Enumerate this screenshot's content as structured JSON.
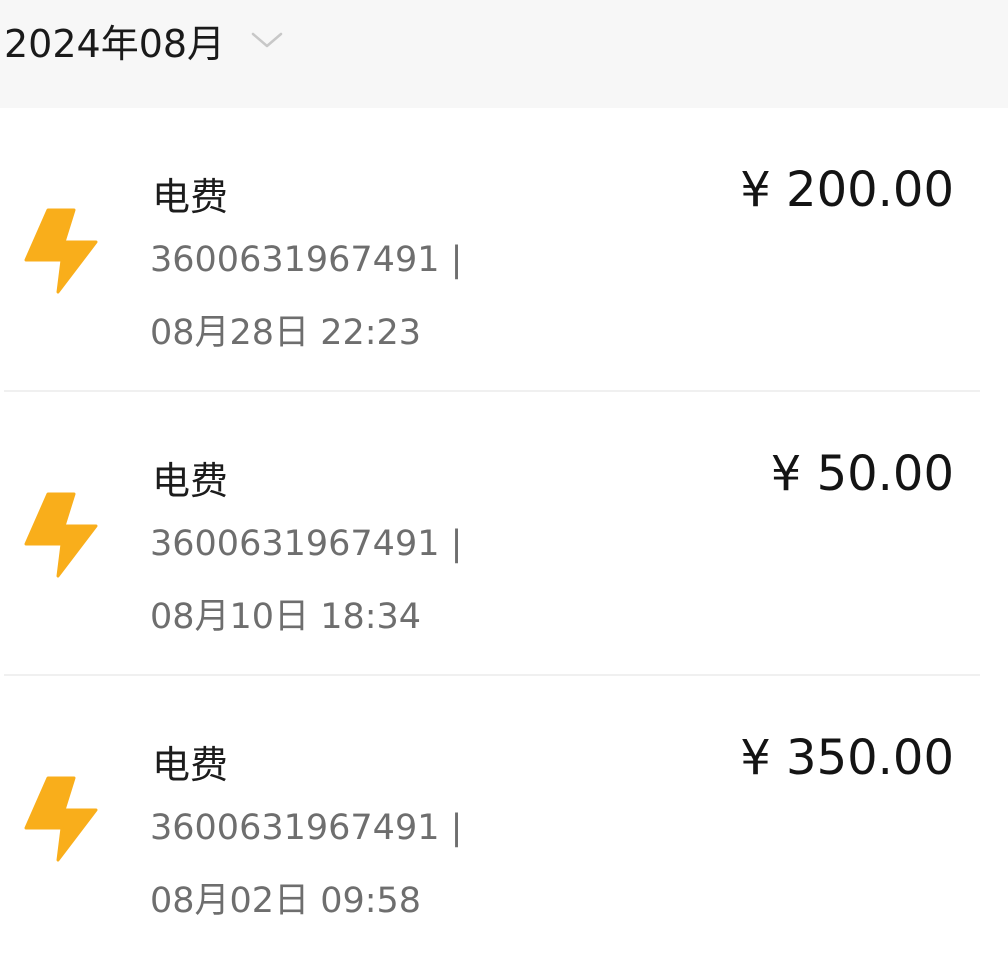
{
  "header": {
    "month": "2024年08月",
    "dropdown_icon": "chevron-down-icon"
  },
  "colors": {
    "bolt": "#F9AE1B",
    "header_bg": "#F7F7F7"
  },
  "transactions": [
    {
      "icon": "lightning-bolt-icon",
      "title": "电费",
      "account": "3600631967491 |",
      "datetime": "08月28日 22:23",
      "amount": "¥ 200.00"
    },
    {
      "icon": "lightning-bolt-icon",
      "title": "电费",
      "account": "3600631967491 |",
      "datetime": "08月10日 18:34",
      "amount": "¥ 50.00"
    },
    {
      "icon": "lightning-bolt-icon",
      "title": "电费",
      "account": "3600631967491 |",
      "datetime": "08月02日 09:58",
      "amount": "¥ 350.00"
    }
  ]
}
